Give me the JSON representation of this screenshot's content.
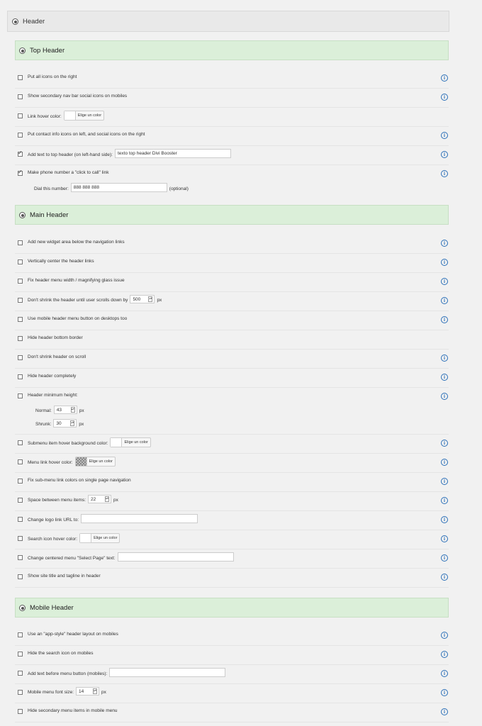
{
  "header": {
    "label": "Header"
  },
  "sections": {
    "top": {
      "label": "Top Header"
    },
    "main": {
      "label": "Main Header"
    },
    "mobile": {
      "label": "Mobile Header"
    }
  },
  "top_rows": [
    {
      "label": "Put all icons on the right"
    },
    {
      "label": "Show secondary nav bar social icons on mobiles"
    },
    {
      "label": "Link hover color:",
      "color_btn": "Elige un color"
    },
    {
      "label": "Put contact info icons on left, and social icons on the right"
    },
    {
      "label": "Add text to top header (on left-hand side):",
      "value": "texto top header Divi Booster",
      "checked": true
    },
    {
      "label": "Make phone number a \"click to call\" link",
      "checked": true,
      "sub_label": "Dial this number:",
      "sub_value": "888 888 888",
      "sub_note": "(optional)"
    }
  ],
  "main_rows": [
    {
      "label": "Add new widget area below the navigation links"
    },
    {
      "label": "Vertically center the header links"
    },
    {
      "label": "Fix header menu width / magnifying glass issue"
    },
    {
      "label": "Don't shrink the header until user scrolls down by",
      "num": "500",
      "unit": "px"
    },
    {
      "label": "Use mobile header menu button on desktops too"
    },
    {
      "label": "Hide header bottom border"
    },
    {
      "label": "Don't shrink header on scroll"
    },
    {
      "label": "Hide header completely"
    },
    {
      "label": "Header minimum height:",
      "normal_label": "Normal:",
      "normal_value": "43",
      "shrunk_label": "Shrunk:",
      "shrunk_value": "30",
      "unit": "px"
    },
    {
      "label": "Submenu item hover background color:",
      "color_btn": "Elige un color"
    },
    {
      "label": "Menu link hover color:",
      "color_btn": "Elige un color"
    },
    {
      "label": "Fix sub-menu link colors on single page navigation"
    },
    {
      "label": "Space between menu items:",
      "num": "22",
      "unit": "px"
    },
    {
      "label": "Change logo link URL to:"
    },
    {
      "label": "Search icon hover color:",
      "color_btn": "Elige un color"
    },
    {
      "label": "Change centered menu \"Select Page\" text:"
    },
    {
      "label": "Show site title and tagline in header"
    }
  ],
  "mobile_rows": [
    {
      "label": "Use an \"app-style\" header layout on mobiles"
    },
    {
      "label": "Hide the search icon on mobiles"
    },
    {
      "label": "Add text before menu button (mobiles):"
    },
    {
      "label": "Mobile menu font size:",
      "num": "14",
      "unit": "px"
    },
    {
      "label": "Hide secondary menu items in mobile menu"
    }
  ],
  "info_icon": "info-icon",
  "colors": {
    "section_bg": "#dbefd9",
    "info": "#2a6fb8",
    "header_bg": "#e9e9e9"
  }
}
